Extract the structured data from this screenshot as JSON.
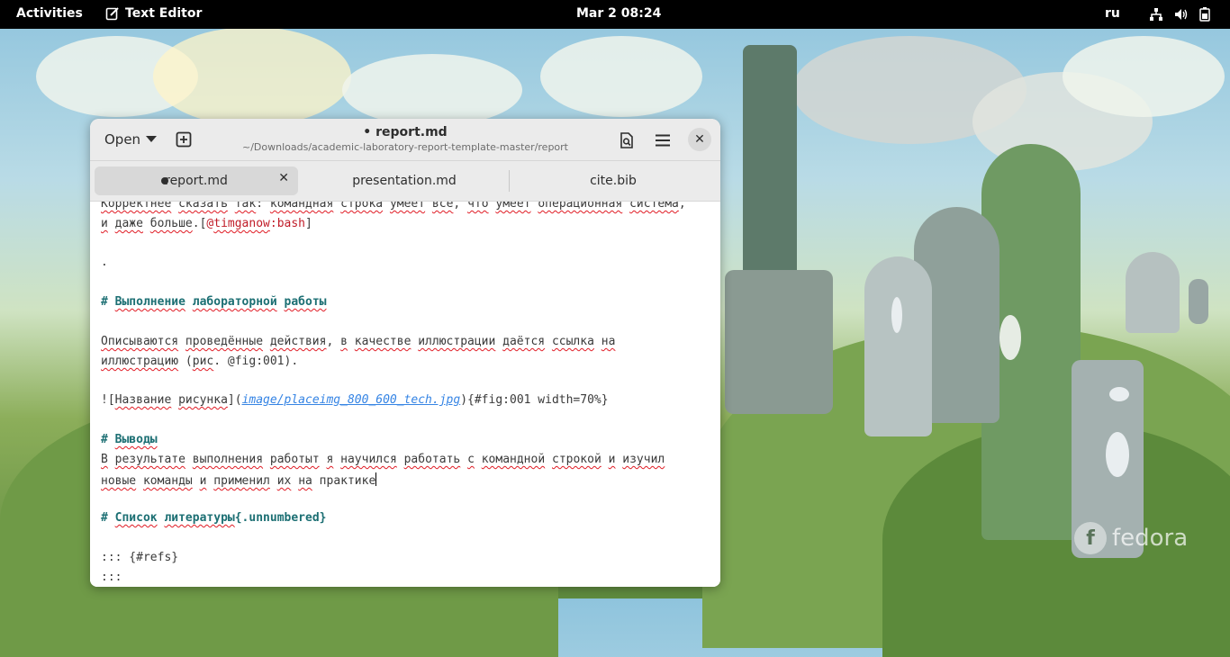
{
  "topbar": {
    "activities": "Activities",
    "app_name": "Text Editor",
    "clock": "Mar 2  08:24",
    "keyboard_layout": "ru",
    "tray_icons": [
      "network-icon",
      "volume-icon",
      "battery-icon"
    ]
  },
  "wallpaper": {
    "logo_text": "fedora"
  },
  "window": {
    "open_label": "Open",
    "title": "report.md",
    "modified_marker": "•",
    "path": "~/Downloads/academic-laboratory-report-template-master/report",
    "tabs": [
      {
        "label": "report.md",
        "active": true,
        "modified": true
      },
      {
        "label": "presentation.md",
        "active": false
      },
      {
        "label": "cite.bib",
        "active": false
      }
    ]
  },
  "editor": {
    "l1a": "Корректнее",
    "l1b": "сказать",
    "l1c": "так",
    "l1d": ":",
    "l1e": "командная",
    "l1f": "строка",
    "l1g": "умеет",
    "l1h": "все",
    "l1i": ",",
    "l1j": "что",
    "l1k": "умеет",
    "l1l": "операционная",
    "l1m": "система",
    "l1n": ",",
    "l2a": "и",
    "l2b": "даже",
    "l2c": "больше",
    "l2d": ".[",
    "l2e": "@",
    "l2f": "timganow",
    "l2g": ":bash",
    "l2h": "]",
    "l3": ".",
    "l4hash": "#",
    "l4a": "Выполнение",
    "l4b": "лабораторной",
    "l4c": "работы",
    "l5a": "Описываются",
    "l5b": "проведённые",
    "l5c": "действия",
    "l5d": ",",
    "l5e": "в",
    "l5f": "качестве",
    "l5g": "иллюстрации",
    "l5h": "даётся",
    "l5i": "ссылка",
    "l5j": "на",
    "l6a": "иллюстрацию",
    "l6b": "(",
    "l6c": "рис",
    "l6d": ". @fig:001).",
    "l7a": "![",
    "l7b": "Название",
    "l7c": "рисунка",
    "l7d": "](",
    "l7e": "image/placeimg_800_600_tech.jpg",
    "l7f": "){#fig:001 width=70%}",
    "l8hash": "#",
    "l8a": "Выводы",
    "l9a": "В",
    "l9b": "результате",
    "l9c": "выполнения",
    "l9d": "работыт",
    "l9e": "я",
    "l9f": "научился",
    "l9g": "работать",
    "l9h": "с",
    "l9i": "командной",
    "l9j": "строкой",
    "l9k": "и",
    "l9l": "изучил",
    "l10a": "новые",
    "l10b": "команды",
    "l10c": "и",
    "l10d": "применил",
    "l10e": "их",
    "l10f": "на",
    "l10g": "практике",
    "l11hash": "#",
    "l11a": "Список",
    "l11b": "литературы",
    "l11c": "{.unnumbered}",
    "l12": "::: {#refs}",
    "l13": ":::"
  },
  "colors": {
    "heading": "#1c6f73",
    "link": "#3584e4",
    "citation": "#c01c28",
    "spellcheck": "#e01b24"
  }
}
